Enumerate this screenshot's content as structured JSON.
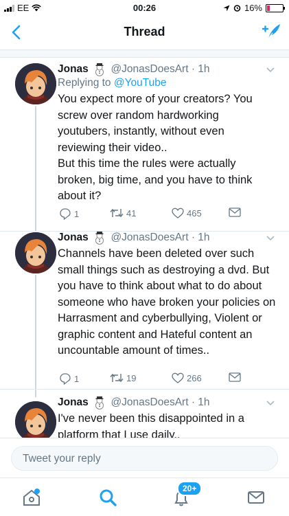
{
  "status": {
    "carrier": "EE",
    "time": "00:26",
    "battery_pct": "16%",
    "battery_level": 0.16
  },
  "nav": {
    "title": "Thread"
  },
  "tweets": [
    {
      "name": "Jonas",
      "handle": "@JonasDoesArt",
      "time": "· 1h",
      "reply_prefix": "Replying to ",
      "reply_to": "@YouTube",
      "text": "You expect more of your creators? You screw over random hardworking youtubers, instantly, without even reviewing their video..\nBut this time the rules were actually broken, big time, and you have to think about it?",
      "replies": "1",
      "retweets": "41",
      "likes": "465"
    },
    {
      "name": "Jonas",
      "handle": "@JonasDoesArt",
      "time": "· 1h",
      "text": "Channels have been deleted over such small things such as destroying a dvd. But you have to think about what to do about someone who have broken your policies on Harrasment and cyberbullying, Violent or graphic content and Hateful content an uncountable amount of times..",
      "replies": "1",
      "retweets": "19",
      "likes": "266"
    },
    {
      "name": "Jonas",
      "handle": "@JonasDoesArt",
      "time": "· 1h",
      "text": "I've never been this disappointed in a platform that I use daily.."
    }
  ],
  "reply_box": {
    "placeholder": "Tweet your reply"
  },
  "tabs": {
    "notifications_badge": "20+"
  },
  "colors": {
    "accent": "#1da1f2",
    "muted": "#657786",
    "divider": "#e1e8ed"
  }
}
